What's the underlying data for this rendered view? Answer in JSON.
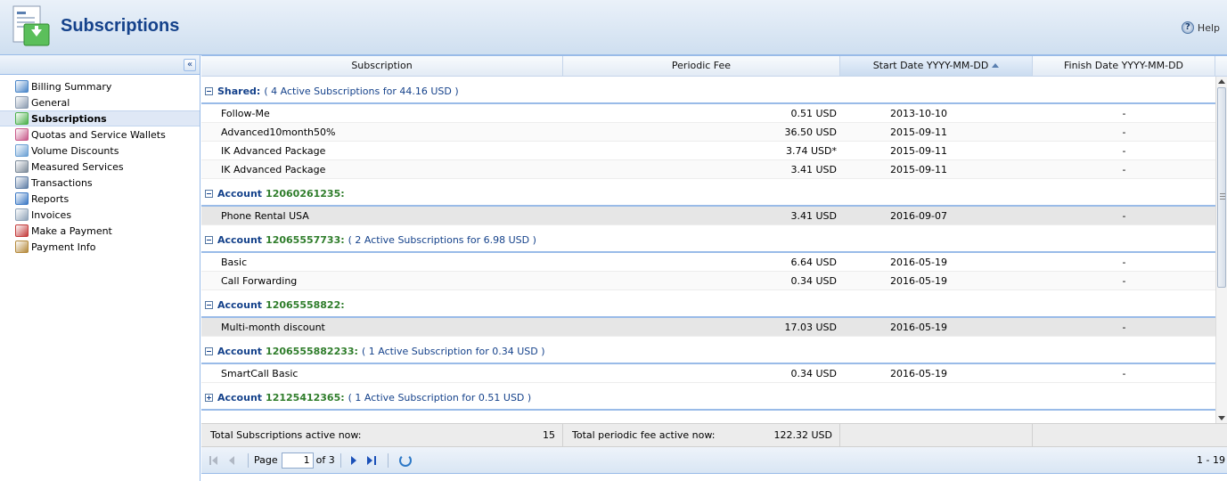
{
  "header": {
    "title": "Subscriptions",
    "help_label": "Help"
  },
  "sidebar": {
    "items": [
      {
        "label": "Billing Summary",
        "icon": "chart-icon",
        "color": "#4a86c8"
      },
      {
        "label": "General",
        "icon": "gear-icon",
        "color": "#8a9bb0"
      },
      {
        "label": "Subscriptions",
        "icon": "subscriptions-icon",
        "color": "#4bb04b",
        "active": true
      },
      {
        "label": "Quotas and Service Wallets",
        "icon": "wallet-icon",
        "color": "#c85a8a"
      },
      {
        "label": "Volume Discounts",
        "icon": "discount-icon",
        "color": "#6aa0d4"
      },
      {
        "label": "Measured Services",
        "icon": "meter-icon",
        "color": "#7d8b9a"
      },
      {
        "label": "Transactions",
        "icon": "transactions-icon",
        "color": "#5f7ea6"
      },
      {
        "label": "Reports",
        "icon": "reports-icon",
        "color": "#3b78c4"
      },
      {
        "label": "Invoices",
        "icon": "invoice-icon",
        "color": "#8fa3b8"
      },
      {
        "label": "Make a Payment",
        "icon": "payment-icon",
        "color": "#c43c3c"
      },
      {
        "label": "Payment Info",
        "icon": "payment-info-icon",
        "color": "#b58a3c"
      }
    ]
  },
  "columns": {
    "subscription": "Subscription",
    "periodic_fee": "Periodic Fee",
    "start_date": "Start Date YYYY-MM-DD",
    "finish_date": "Finish Date YYYY-MM-DD"
  },
  "groups": [
    {
      "name": "Shared:",
      "number": "",
      "summary": "( 4 Active Subscriptions for 44.16 USD )",
      "expanded": true,
      "rows": [
        {
          "name": "Follow-Me",
          "fee": "0.51 USD",
          "start": "2013-10-10",
          "finish": "-"
        },
        {
          "name": "Advanced10month50%",
          "fee": "36.50 USD",
          "start": "2015-09-11",
          "finish": "-"
        },
        {
          "name": "IK Advanced Package",
          "fee": "3.74 USD*",
          "start": "2015-09-11",
          "finish": "-"
        },
        {
          "name": "IK Advanced Package",
          "fee": "3.41 USD",
          "start": "2015-09-11",
          "finish": "-"
        }
      ]
    },
    {
      "name": "Account",
      "number": "12060261235:",
      "summary": "",
      "expanded": true,
      "rows": [
        {
          "name": "Phone Rental USA",
          "fee": "3.41 USD",
          "start": "2016-09-07",
          "finish": "-",
          "selected": true
        }
      ]
    },
    {
      "name": "Account",
      "number": "12065557733:",
      "summary": "( 2 Active Subscriptions for 6.98 USD )",
      "expanded": true,
      "rows": [
        {
          "name": "Basic",
          "fee": "6.64 USD",
          "start": "2016-05-19",
          "finish": "-"
        },
        {
          "name": "Call Forwarding",
          "fee": "0.34 USD",
          "start": "2016-05-19",
          "finish": "-"
        }
      ]
    },
    {
      "name": "Account",
      "number": "12065558822:",
      "summary": "",
      "expanded": true,
      "rows": [
        {
          "name": "Multi-month discount",
          "fee": "17.03 USD",
          "start": "2016-05-19",
          "finish": "-",
          "selected": true
        }
      ]
    },
    {
      "name": "Account",
      "number": "1206555882233:",
      "summary": "( 1 Active Subscription for 0.34 USD )",
      "expanded": true,
      "rows": [
        {
          "name": "SmartCall Basic",
          "fee": "0.34 USD",
          "start": "2016-05-19",
          "finish": "-"
        }
      ]
    },
    {
      "name": "Account",
      "number": "12125412365:",
      "summary": "( 1 Active Subscription for 0.51 USD )",
      "expanded": false,
      "rows": []
    }
  ],
  "summary": {
    "total_subs_label": "Total Subscriptions active now:",
    "total_subs_value": "15",
    "total_fee_label": "Total periodic fee active now:",
    "total_fee_value": "122.32 USD"
  },
  "pager": {
    "page_label": "Page",
    "page_value": "1",
    "of_label": "of 3",
    "range": "1 - 19"
  }
}
